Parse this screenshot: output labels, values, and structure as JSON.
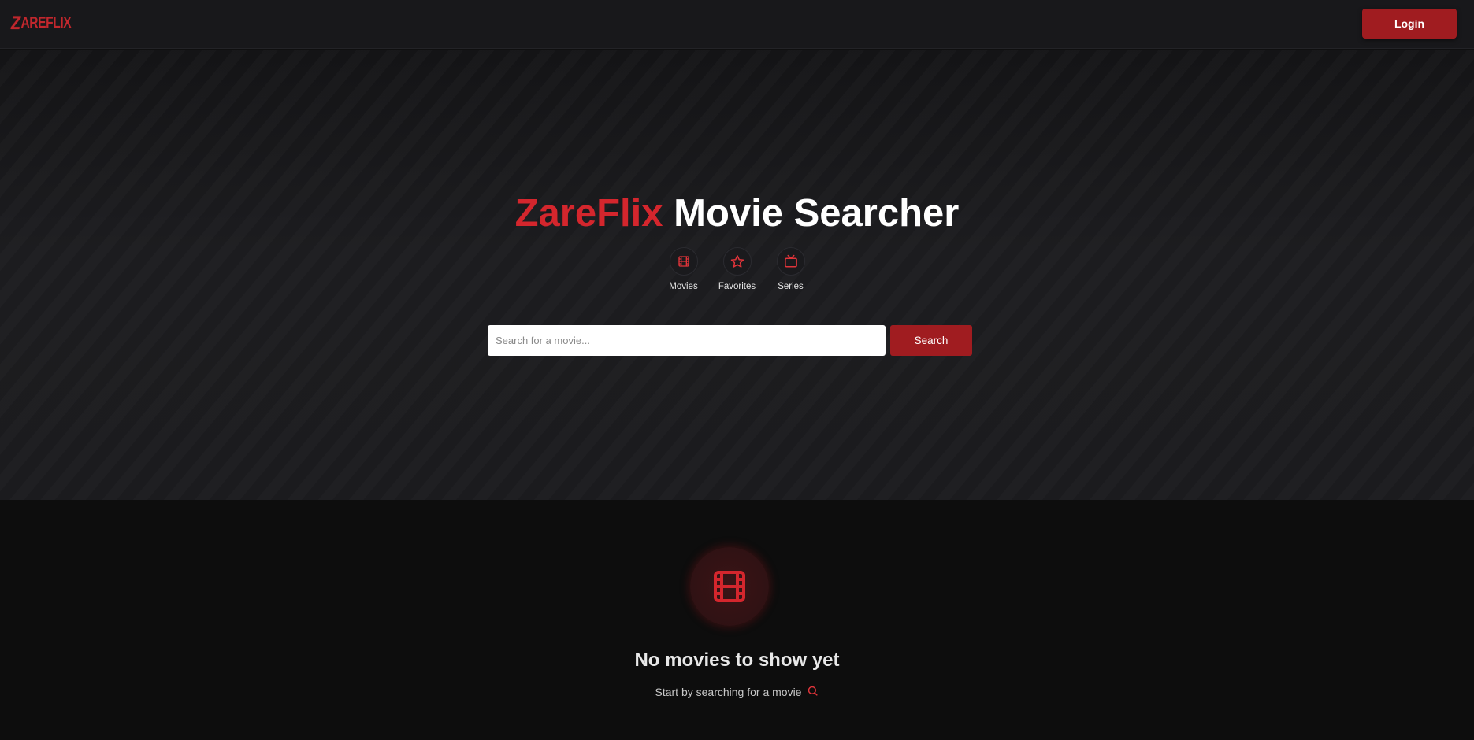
{
  "header": {
    "logo_text": "AREFLIX",
    "logo_initial": "Z",
    "login_label": "Login"
  },
  "hero": {
    "title_brand": "ZareFlix",
    "title_rest": "Movie Searcher",
    "nav": [
      {
        "label": "Movies",
        "icon": "film-icon"
      },
      {
        "label": "Favorites",
        "icon": "star-icon"
      },
      {
        "label": "Series",
        "icon": "tv-icon"
      }
    ],
    "search": {
      "placeholder": "Search for a movie...",
      "value": "",
      "button_label": "Search"
    }
  },
  "empty_state": {
    "icon": "film-icon",
    "title": "No movies to show yet",
    "subtitle": "Start by searching for a movie",
    "subtitle_icon": "search-icon"
  },
  "colors": {
    "accent": "#d4262d",
    "button": "#a01c20",
    "header_bg": "#18181b",
    "page_bg": "#0f0f10"
  }
}
